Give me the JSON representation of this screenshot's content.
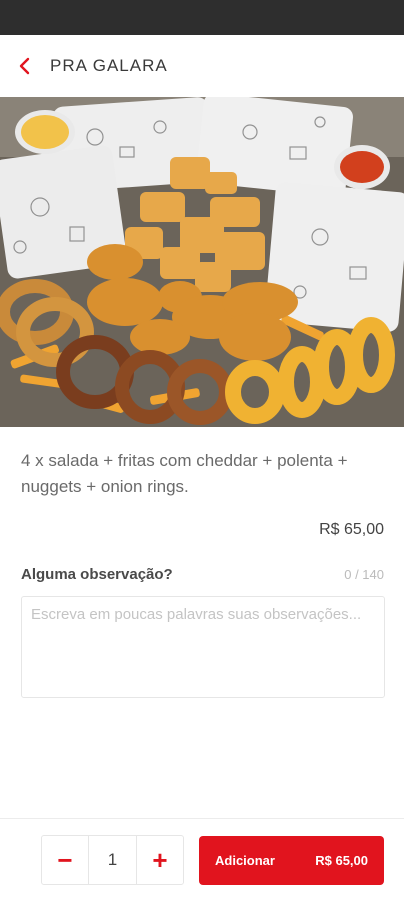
{
  "header": {
    "title": "PRA GALARA",
    "back_icon": "chevron-left-icon"
  },
  "product": {
    "image_alt": "",
    "description": "4 x salada + fritas com cheddar + polenta + nuggets + onion rings.",
    "price": "R$ 65,00"
  },
  "observation": {
    "label": "Alguma observação?",
    "counter": "0 / 140",
    "placeholder": "Escreva em poucas palavras suas observações..."
  },
  "footer": {
    "minus_label": "−",
    "quantity": "1",
    "plus_label": "+",
    "add_label": "Adicionar",
    "add_price": "R$ 65,00"
  },
  "colors": {
    "accent": "#e1141e",
    "status_bar": "#2e2e2e"
  }
}
